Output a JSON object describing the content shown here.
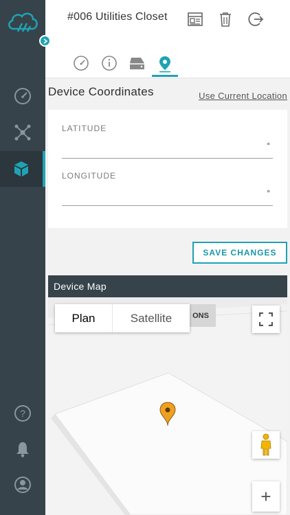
{
  "header": {
    "title": "#006 Utilities Closet"
  },
  "icons": {
    "header": [
      "report-icon",
      "trash-icon",
      "logout-icon"
    ],
    "tabs": [
      "gauge-icon",
      "info-icon",
      "device-icon",
      "location-pin-icon"
    ],
    "sidebar": [
      "dashboard-icon",
      "network-icon",
      "devices-cube-icon",
      "help-icon",
      "bell-icon",
      "user-icon"
    ]
  },
  "coordinates": {
    "title": "Device Coordinates",
    "use_current_location": "Use Current Location",
    "latitude_label": "LATITUDE",
    "latitude_value": "",
    "longitude_label": "LONGITUDE",
    "longitude_value": "",
    "degree_symbol": "°"
  },
  "save_button": "SAVE CHANGES",
  "map": {
    "title": "Device Map",
    "type_plan": "Plan",
    "type_satellite": "Satellite",
    "chip_text": "ONS",
    "zoom_in": "+"
  },
  "colors": {
    "accent": "#1fa3b4",
    "sidebar": "#36434b",
    "pin": "#f0a020"
  }
}
